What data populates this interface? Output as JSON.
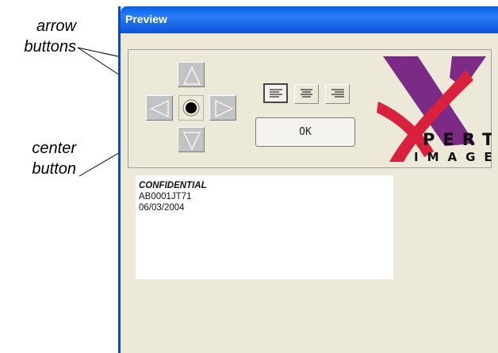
{
  "callouts": {
    "arrow_label_line1": "arrow",
    "arrow_label_line2": "buttons",
    "center_label_line1": "center",
    "center_label_line2": "button"
  },
  "window": {
    "title": "Preview"
  },
  "controls": {
    "ok_label": "OK",
    "alignment_options": [
      "align-left",
      "align-center",
      "align-right"
    ],
    "selected_alignment": "align-left"
  },
  "preview": {
    "lines": [
      "CONFIDENTIAL",
      "AB0001JT71",
      "06/03/2004"
    ]
  },
  "logo": {
    "line1": "PERT",
    "line2": "IMAGE",
    "brand_colors": {
      "red": "#d9203c",
      "purple": "#7b2b86"
    }
  },
  "colors": {
    "title_bar": "#0a5fe8",
    "window_bg": "#ece9d8",
    "arrow_button_bg": "#c3c3c3"
  }
}
